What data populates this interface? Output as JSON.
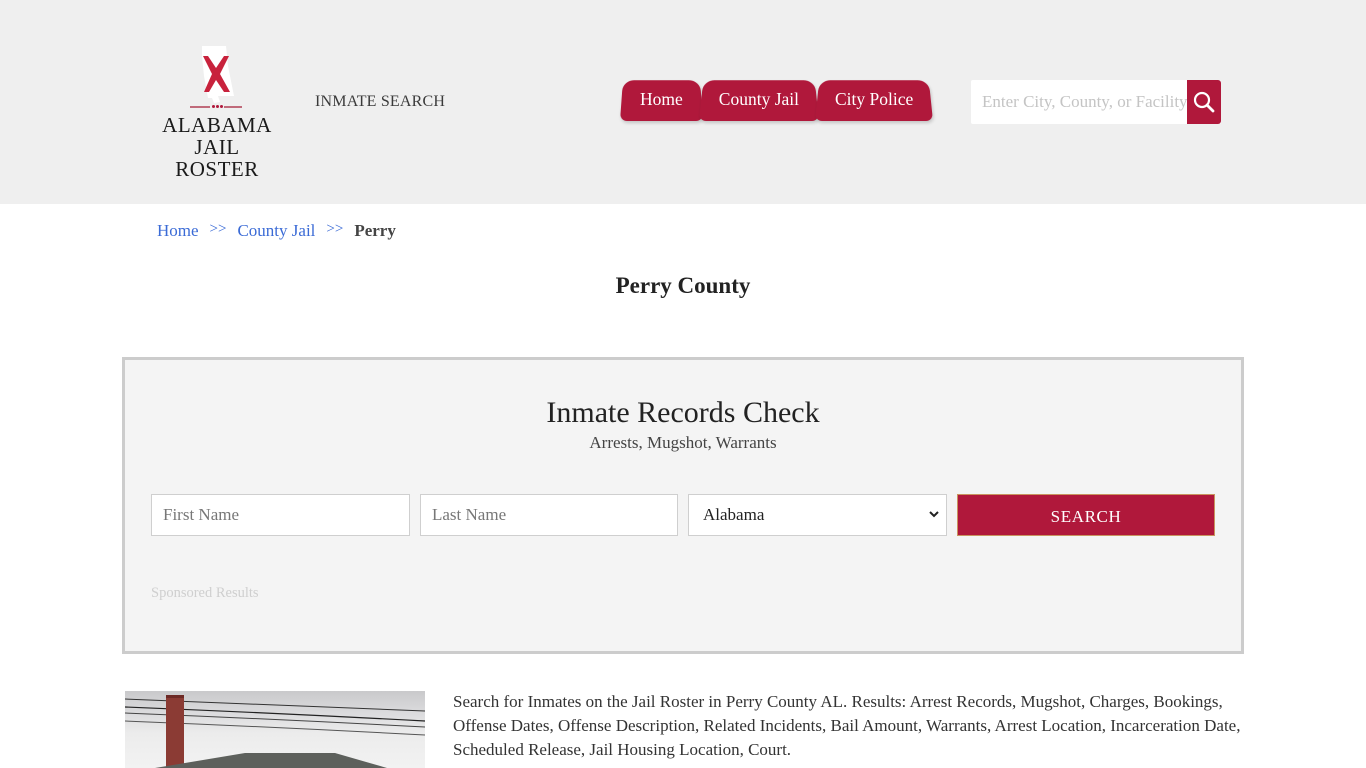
{
  "header": {
    "logo": {
      "line1": "ALABAMA",
      "line2": "JAIL ROSTER",
      "icon": "alabama-map-flag-icon"
    },
    "tagline": "INMATE SEARCH",
    "nav": [
      {
        "label": "Home"
      },
      {
        "label": "County Jail"
      },
      {
        "label": "City Police"
      }
    ],
    "search": {
      "placeholder": "Enter City, County, or Facility",
      "value": "",
      "icon": "search-icon"
    }
  },
  "breadcrumb": {
    "items": [
      {
        "label": "Home"
      },
      {
        "label": "County Jail"
      }
    ],
    "separator": ">>",
    "current": "Perry"
  },
  "page": {
    "title": "Perry County"
  },
  "records_check": {
    "title": "Inmate Records Check",
    "subtitle": "Arrests, Mugshot, Warrants",
    "first_name_placeholder": "First Name",
    "last_name_placeholder": "Last Name",
    "state_selected": "Alabama",
    "search_label": "SEARCH",
    "sponsored_label": "Sponsored Results"
  },
  "content": {
    "photo_alt": "Perry County jail facility",
    "description": "Search for Inmates on the Jail Roster in Perry County AL. Results: Arrest Records, Mugshot, Charges, Bookings, Offense Dates, Offense Description, Related Incidents, Bail Amount, Warrants, Arrest Location, Incarceration Date, Scheduled Release, Jail Housing Location, Court."
  },
  "colors": {
    "brand": "#b0183b",
    "link": "#3b6bd6",
    "header_bg": "#efefef",
    "panel_bg": "#f4f4f4"
  }
}
